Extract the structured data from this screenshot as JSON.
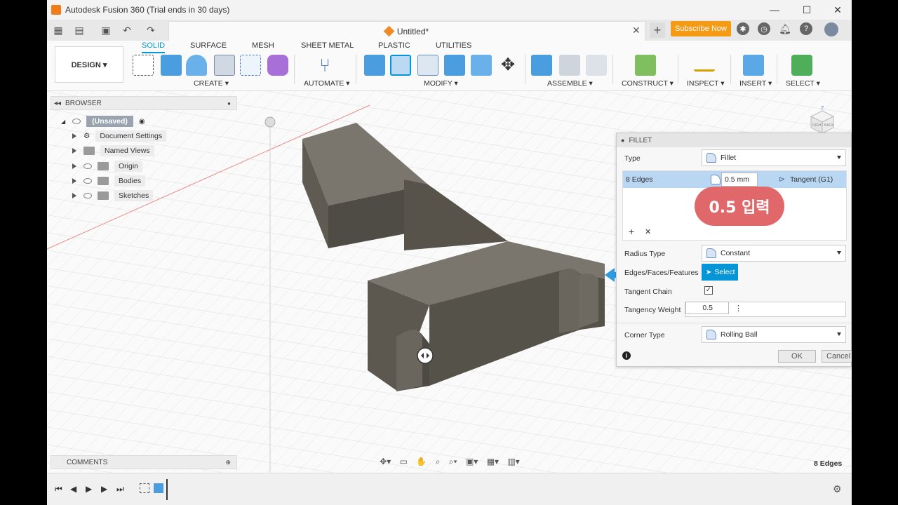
{
  "window": {
    "title": "Autodesk Fusion 360 (Trial ends in 30 days)",
    "minimize": "—",
    "maximize": "☐",
    "close": "✕"
  },
  "tabbar": {
    "doc_title": "Untitled*",
    "close_tab": "✕",
    "new_tab": "+",
    "subscribe": "Subscribe Now"
  },
  "ribbon": {
    "workspace": "DESIGN ▾",
    "tabs": [
      "SOLID",
      "SURFACE",
      "MESH",
      "SHEET METAL",
      "PLASTIC",
      "UTILITIES"
    ],
    "groups": [
      "CREATE ▾",
      "AUTOMATE ▾",
      "MODIFY ▾",
      "ASSEMBLE ▾",
      "CONSTRUCT ▾",
      "INSPECT ▾",
      "INSERT ▾",
      "SELECT ▾"
    ]
  },
  "browser": {
    "title": "BROWSER",
    "root": "(Unsaved)",
    "items": [
      "Document Settings",
      "Named Views",
      "Origin",
      "Bodies",
      "Sketches"
    ]
  },
  "fillet": {
    "title": "FILLET",
    "type_label": "Type",
    "type_value": "Fillet",
    "edges_label": "8 Edges",
    "radius_value": "0.5 mm",
    "tangent_value": "Tangent (G1)",
    "add": "+",
    "remove": "✕",
    "radius_type_label": "Radius Type",
    "radius_type_value": "Constant",
    "edges_faces_label": "Edges/Faces/Features",
    "select_label": "Select",
    "tangent_chain_label": "Tangent Chain",
    "tangency_weight_label": "Tangency Weight",
    "tangency_weight_value": "0.5",
    "corner_type_label": "Corner Type",
    "corner_type_value": "Rolling Ball",
    "ok": "OK",
    "cancel": "Cancel"
  },
  "annotation": {
    "callout": "0.5 입력"
  },
  "comments": {
    "title": "COMMENTS"
  },
  "status": {
    "selection": "8 Edges"
  },
  "viewcube": {
    "right": "RIGHT",
    "back": "BACK",
    "z": "Z"
  },
  "colors": {
    "accent": "#0696d7",
    "subscribe": "#f59a14",
    "callout": "#e0686a",
    "body": "#6e6a62"
  }
}
